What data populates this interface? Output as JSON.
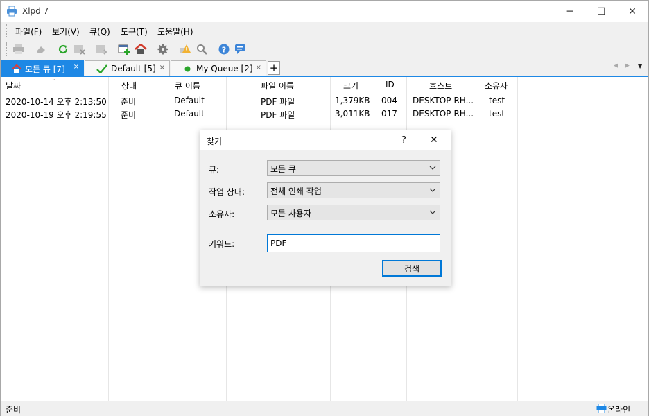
{
  "window": {
    "title": "Xlpd 7",
    "minimize_glyph": "─",
    "maximize_glyph": "☐",
    "close_glyph": "✕"
  },
  "menu": [
    "파일(F)",
    "보기(V)",
    "큐(Q)",
    "도구(T)",
    "도움말(H)"
  ],
  "tabs": [
    {
      "label": "모든 큐 [7]",
      "icon": "home-icon"
    },
    {
      "label": "Default [5]",
      "icon": "check-icon"
    },
    {
      "label": "My Queue [2]",
      "icon": "dot-icon"
    }
  ],
  "tab_close": "×",
  "tab_add": "+",
  "columns": [
    "날짜",
    "상태",
    "큐 이름",
    "파일 이름",
    "크기",
    "ID",
    "호스트",
    "소유자"
  ],
  "rows": [
    [
      "2020-10-14 오후 2:13:50",
      "준비",
      "Default",
      "PDF 파일",
      "1,379KB",
      "004",
      "DESKTOP-RH...",
      "test"
    ],
    [
      "2020-10-19 오후 2:19:55",
      "준비",
      "Default",
      "PDF 파일",
      "3,011KB",
      "017",
      "DESKTOP-RH...",
      "test"
    ]
  ],
  "status": {
    "left": "준비",
    "right": "온라인"
  },
  "dialog": {
    "title": "찾기",
    "help": "?",
    "close": "✕",
    "queue_label": "큐:",
    "queue_value": "모든 큐",
    "state_label": "작업 상태:",
    "state_value": "전체 인쇄 작업",
    "owner_label": "소유자:",
    "owner_value": "모든 사용자",
    "keyword_label": "키워드:",
    "keyword_value": "PDF",
    "search_button": "검색"
  },
  "colors": {
    "accent": "#1e88e5",
    "green": "#2aa52a",
    "red": "#d23a2a"
  }
}
